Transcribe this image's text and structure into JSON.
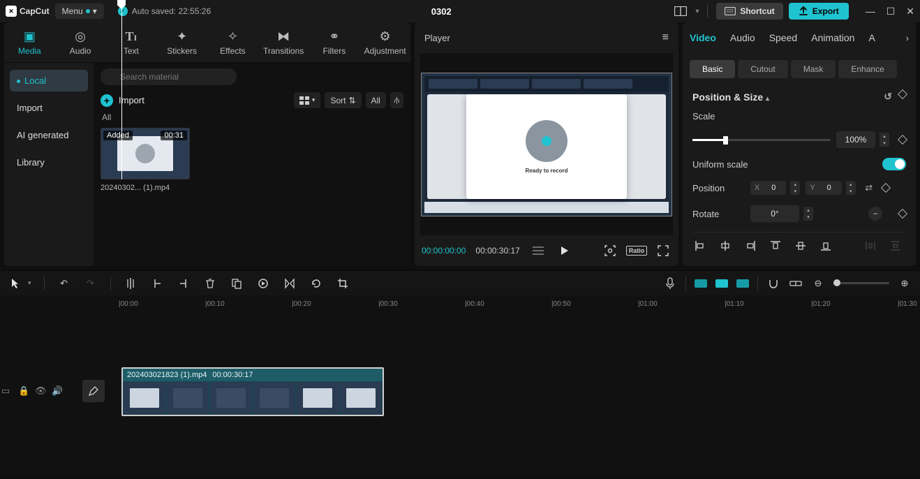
{
  "titlebar": {
    "app_name": "CapCut",
    "menu_label": "Menu",
    "autosave_label": "Auto saved: 22:55:26",
    "project_title": "0302",
    "shortcut_label": "Shortcut",
    "export_label": "Export"
  },
  "media_tabs": {
    "media": "Media",
    "audio": "Audio",
    "text": "Text",
    "stickers": "Stickers",
    "effects": "Effects",
    "transitions": "Transitions",
    "filters": "Filters",
    "adjustment": "Adjustment"
  },
  "media_sidebar": {
    "local": "Local",
    "import": "Import",
    "ai": "AI generated",
    "library": "Library"
  },
  "media_main": {
    "search_placeholder": "Search material",
    "import_label": "Import",
    "sort_label": "Sort",
    "all_label": "All",
    "section_all": "All",
    "clip": {
      "added_label": "Added",
      "duration": "00:31",
      "filename": "20240302... (1).mp4"
    }
  },
  "player": {
    "header_label": "Player",
    "timecode_current": "00:00:00:00",
    "timecode_total": "00:00:30:17",
    "preview_text": "Ready to record",
    "ratio_label": "Ratio"
  },
  "inspector": {
    "tabs": {
      "video": "Video",
      "audio": "Audio",
      "speed": "Speed",
      "animation": "Animation",
      "ai": "A"
    },
    "subtabs": {
      "basic": "Basic",
      "cutout": "Cutout",
      "mask": "Mask",
      "enhance": "Enhance"
    },
    "section_title": "Position & Size",
    "scale_label": "Scale",
    "scale_value": "100%",
    "uniform_label": "Uniform scale",
    "position_label": "Position",
    "pos_x_label": "X",
    "pos_x_value": "0",
    "pos_y_label": "Y",
    "pos_y_value": "0",
    "rotate_label": "Rotate",
    "rotate_value": "0°"
  },
  "timeline": {
    "ruler": [
      "00:00",
      "00:10",
      "00:20",
      "00:30",
      "00:40",
      "00:50",
      "01:00",
      "01:10",
      "01:20",
      "01:30"
    ],
    "clip_name": "202403021823 (1).mp4",
    "clip_duration": "00:00:30:17"
  }
}
